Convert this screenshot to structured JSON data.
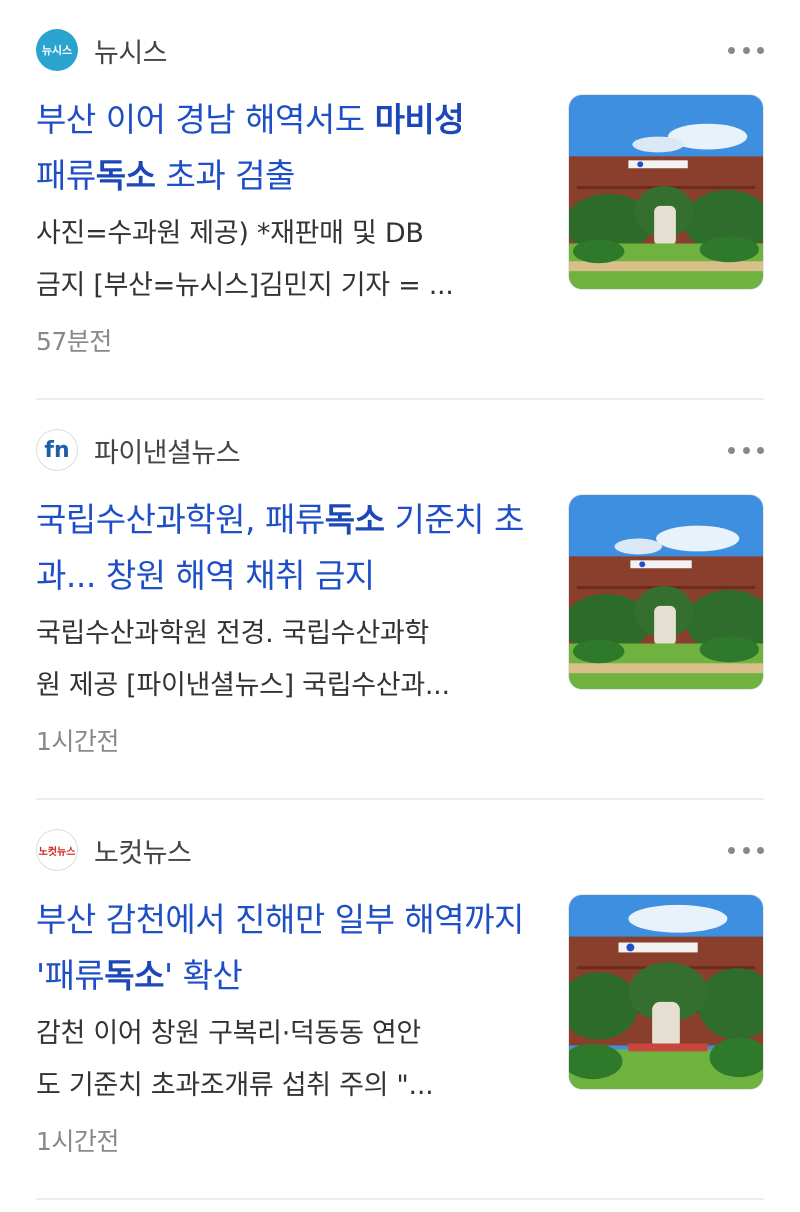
{
  "articles": [
    {
      "source": "뉴시스",
      "logo_text": "뉴시스",
      "title_parts": [
        {
          "text": "부산 이어 경남 해역서도 ",
          "bold": false
        },
        {
          "text": "마비성",
          "bold": true
        },
        {
          "text": "패류",
          "bold": false
        },
        {
          "text": "독소",
          "bold": true
        },
        {
          "text": " 초과 검출",
          "bold": false
        }
      ],
      "snippet_lines": [
        "사진=수과원 제공) *재판매 및 DB",
        "금지 [부산=뉴시스]김민지 기자 = ..."
      ],
      "time": "57분전",
      "thumbnail_icon": "building-photo-icon"
    },
    {
      "source": "파이낸셜뉴스",
      "logo_text": "fn",
      "title_parts": [
        {
          "text": "국립수산과학원, 패류",
          "bold": false
        },
        {
          "text": "독소",
          "bold": true
        },
        {
          "text": " 기준치 초과... 창원 해역 채취 금지",
          "bold": false
        }
      ],
      "snippet_lines": [
        "국립수산과학원 전경. 국립수산과학",
        "원 제공 [파이낸셜뉴스] 국립수산과..."
      ],
      "time": "1시간전",
      "thumbnail_icon": "building-photo-icon"
    },
    {
      "source": "노컷뉴스",
      "logo_text": "노컷뉴스",
      "title_parts": [
        {
          "text": "부산 감천에서 진해만 일부 해역까지 '패류",
          "bold": false
        },
        {
          "text": "독소",
          "bold": true
        },
        {
          "text": "' 확산",
          "bold": false
        }
      ],
      "snippet_lines": [
        "감천 이어 창원 구복리·덕동동 연안",
        "도 기준치 초과조개류 섭취 주의 \"..."
      ],
      "time": "1시간전",
      "thumbnail_icon": "building-photo-icon"
    }
  ],
  "colors": {
    "title": "#1f4fc6",
    "snippet": "#333333",
    "meta": "#888888",
    "divider": "#ececec"
  }
}
